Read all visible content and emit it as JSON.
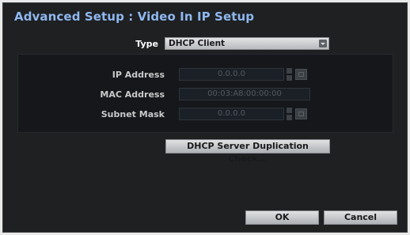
{
  "dialog": {
    "title": "Advanced Setup : Video In IP Setup"
  },
  "type_row": {
    "label": "Type",
    "selected": "DHCP Client"
  },
  "fields": {
    "ip": {
      "label": "IP Address",
      "value": "0.0.0.0"
    },
    "mac": {
      "label": "MAC Address",
      "value": "00:03:A8:00:00:00"
    },
    "subnet": {
      "label": "Subnet Mask",
      "value": "0.0.0.0"
    }
  },
  "buttons": {
    "dhcp_check": "DHCP Server Duplication Check...",
    "ok": "OK",
    "cancel": "Cancel"
  },
  "colors": {
    "title": "#8fb7ee",
    "background": "#1e2022",
    "panel": "#15171a"
  }
}
